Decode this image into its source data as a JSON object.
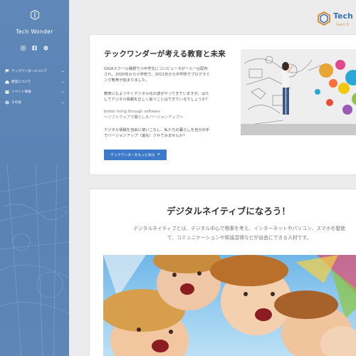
{
  "sidebar": {
    "brand": "Tech Wonder",
    "nav": [
      {
        "label": "テックワンダーについて",
        "icon": "flag-icon"
      },
      {
        "label": "教室について",
        "icon": "home-icon"
      },
      {
        "label": "イベント情報",
        "icon": "calendar-icon"
      },
      {
        "label": "その他",
        "icon": "globe-icon"
      }
    ]
  },
  "header": {
    "logo_text": "Tech W",
    "logo_tagline": "Feel it, Tr"
  },
  "intro": {
    "title": "テックワンダーが考える教育と未来",
    "p1a": "GIGAスクール構想で小中学生にコンピュータが一人一台配布",
    "p1b": "され、2020年から小学校で、2021年から中学校でプログラミ",
    "p1c": "ング教育が始まりました。",
    "p2a": "教育にもようやくデジタル化の波がやってきていますが、はた",
    "p2b": "してデジタル情報を正しく扱うことはできているでしょうか？",
    "p3a": "better living through software",
    "p3b": "〜ソフトウェアで暮らしをバージョンアップ〜",
    "p4a": "デジタル情報を自由に使いこなし、私たちの暮らしを自分の手",
    "p4b": "でバージョンアップ（進化）させてみませんか？",
    "button": "テックワンダーをもっと知る"
  },
  "native": {
    "title": "デジタルネイティブになろう！",
    "line1": "デジタルネイティブとは、デジタル中心で物事を考え、インターネットやパソコン、スマホを駆使",
    "line2": "て、コミュニケーションや知識習得などが自由にできる人材です。"
  },
  "colors": {
    "sidebar": "#5a83b4",
    "accent": "#3d7ac9",
    "brand_orange": "#d4862b"
  }
}
